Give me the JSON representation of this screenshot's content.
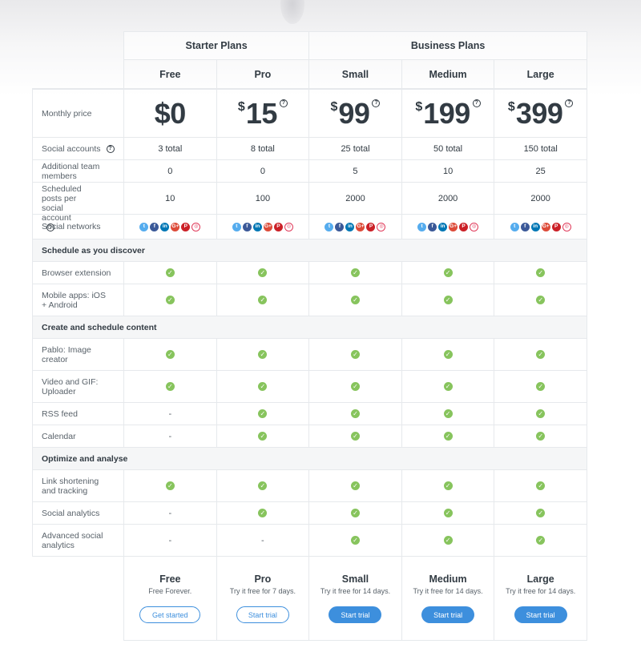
{
  "groups": {
    "starter": "Starter Plans",
    "business": "Business Plans"
  },
  "plans": [
    {
      "name": "Free",
      "currency": "",
      "price": "$0",
      "has_help": false,
      "social_accounts": "3 total",
      "team_members": "0",
      "scheduled_posts": "10",
      "browser_extension": "check",
      "mobile_apps": "check",
      "pablo": "check",
      "video_gif": "check",
      "rss": "-",
      "calendar": "-",
      "link_shortening": "check",
      "social_analytics": "-",
      "advanced_analytics": "-",
      "cta_title": "Free",
      "cta_sub": "Free Forever.",
      "cta_button": "Get started",
      "cta_style": "outline"
    },
    {
      "name": "Pro",
      "currency": "$",
      "price": "15",
      "has_help": true,
      "social_accounts": "8 total",
      "team_members": "0",
      "scheduled_posts": "100",
      "browser_extension": "check",
      "mobile_apps": "check",
      "pablo": "check",
      "video_gif": "check",
      "rss": "check",
      "calendar": "check",
      "link_shortening": "check",
      "social_analytics": "check",
      "advanced_analytics": "-",
      "cta_title": "Pro",
      "cta_sub": "Try it free for 7 days.",
      "cta_button": "Start trial",
      "cta_style": "outline"
    },
    {
      "name": "Small",
      "currency": "$",
      "price": "99",
      "has_help": true,
      "social_accounts": "25 total",
      "team_members": "5",
      "scheduled_posts": "2000",
      "browser_extension": "check",
      "mobile_apps": "check",
      "pablo": "check",
      "video_gif": "check",
      "rss": "check",
      "calendar": "check",
      "link_shortening": "check",
      "social_analytics": "check",
      "advanced_analytics": "check",
      "cta_title": "Small",
      "cta_sub": "Try it free for 14 days.",
      "cta_button": "Start trial",
      "cta_style": "solid"
    },
    {
      "name": "Medium",
      "currency": "$",
      "price": "199",
      "has_help": true,
      "social_accounts": "50 total",
      "team_members": "10",
      "scheduled_posts": "2000",
      "browser_extension": "check",
      "mobile_apps": "check",
      "pablo": "check",
      "video_gif": "check",
      "rss": "check",
      "calendar": "check",
      "link_shortening": "check",
      "social_analytics": "check",
      "advanced_analytics": "check",
      "cta_title": "Medium",
      "cta_sub": "Try it free for 14 days.",
      "cta_button": "Start trial",
      "cta_style": "solid"
    },
    {
      "name": "Large",
      "currency": "$",
      "price": "399",
      "has_help": true,
      "social_accounts": "150 total",
      "team_members": "25",
      "scheduled_posts": "2000",
      "browser_extension": "check",
      "mobile_apps": "check",
      "pablo": "check",
      "video_gif": "check",
      "rss": "check",
      "calendar": "check",
      "link_shortening": "check",
      "social_analytics": "check",
      "advanced_analytics": "check",
      "cta_title": "Large",
      "cta_sub": "Try it free for 14 days.",
      "cta_button": "Start trial",
      "cta_style": "solid"
    }
  ],
  "labels": {
    "monthly_price": "Monthly price",
    "social_accounts": "Social accounts",
    "team_members": "Additional team members",
    "scheduled_posts": "Scheduled posts per social account",
    "social_networks": "Social networks"
  },
  "help_glyph": "?",
  "social_networks": [
    {
      "icon": "twitter-icon",
      "glyph": "t",
      "color": "#55acee"
    },
    {
      "icon": "facebook-icon",
      "glyph": "f",
      "color": "#3b5998"
    },
    {
      "icon": "linkedin-icon",
      "glyph": "in",
      "color": "#0077b5"
    },
    {
      "icon": "google-plus-icon",
      "glyph": "G+",
      "color": "#dd4b39"
    },
    {
      "icon": "pinterest-icon",
      "glyph": "P",
      "color": "#cb2027"
    },
    {
      "icon": "instagram-icon",
      "glyph": "◎",
      "color": "#e03a5a"
    }
  ],
  "sections": [
    {
      "title": "Schedule as you discover",
      "rows": [
        {
          "key": "browser_extension",
          "label": "Browser extension",
          "tall": false
        },
        {
          "key": "mobile_apps",
          "label": "Mobile apps: iOS + Android",
          "tall": true
        }
      ]
    },
    {
      "title": "Create and schedule content",
      "rows": [
        {
          "key": "pablo",
          "label": "Pablo: Image creator",
          "tall": true
        },
        {
          "key": "video_gif",
          "label": "Video and GIF: Uploader",
          "tall": true
        },
        {
          "key": "rss",
          "label": "RSS feed",
          "tall": false
        },
        {
          "key": "calendar",
          "label": "Calendar",
          "tall": false
        }
      ]
    },
    {
      "title": "Optimize and analyse",
      "rows": [
        {
          "key": "link_shortening",
          "label": "Link shortening and tracking",
          "tall": true
        },
        {
          "key": "social_analytics",
          "label": "Social analytics",
          "tall": false
        },
        {
          "key": "advanced_analytics",
          "label": "Advanced social analytics",
          "tall": true
        }
      ]
    }
  ],
  "colors": {
    "check": "#87c45d",
    "button": "#3d8fdd",
    "section_bg": "#f5f6f7"
  }
}
